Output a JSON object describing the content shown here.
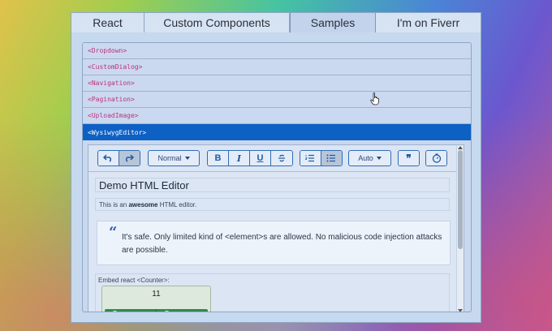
{
  "tabs": [
    {
      "label": "React",
      "active": false
    },
    {
      "label": "Custom Components",
      "active": false
    },
    {
      "label": "Samples",
      "active": true
    },
    {
      "label": "I'm on Fiverr",
      "active": false
    }
  ],
  "samples": {
    "items": [
      "<Dropdown>",
      "<CustomDialog>",
      "<Navigation>",
      "<Pagination>",
      "<UploadImage>",
      "<WysiwygEditor>"
    ],
    "active_item": "<WysiwygEditor>"
  },
  "toolbar": {
    "undo_icon": "undo-icon",
    "redo_icon": "redo-icon",
    "block_format": "Normal",
    "bold": "B",
    "italic": "I",
    "underline": "U",
    "strike_icon": "strikethrough-icon",
    "ordered_list_icon": "ordered-list-icon",
    "bullet_list_icon": "bullet-list-icon",
    "text_direction": "Auto",
    "quote_icon": "quote-icon",
    "embed_icon": "timer-icon"
  },
  "editor": {
    "heading": "Demo HTML Editor",
    "paragraph_prefix": "This is an ",
    "paragraph_bold": "awesome",
    "paragraph_suffix": " HTML editor.",
    "quote_mark": "“",
    "quote": "It's safe. Only limited kind of <element>s are allowed. No malicious code injection attacks are possible.",
    "embed_label": "Embed react <Counter>:",
    "counter_value": "11"
  },
  "colors": {
    "active_item": "#0d60c4",
    "item_text": "#c0307c",
    "counter_button": "#2e8a4b"
  }
}
